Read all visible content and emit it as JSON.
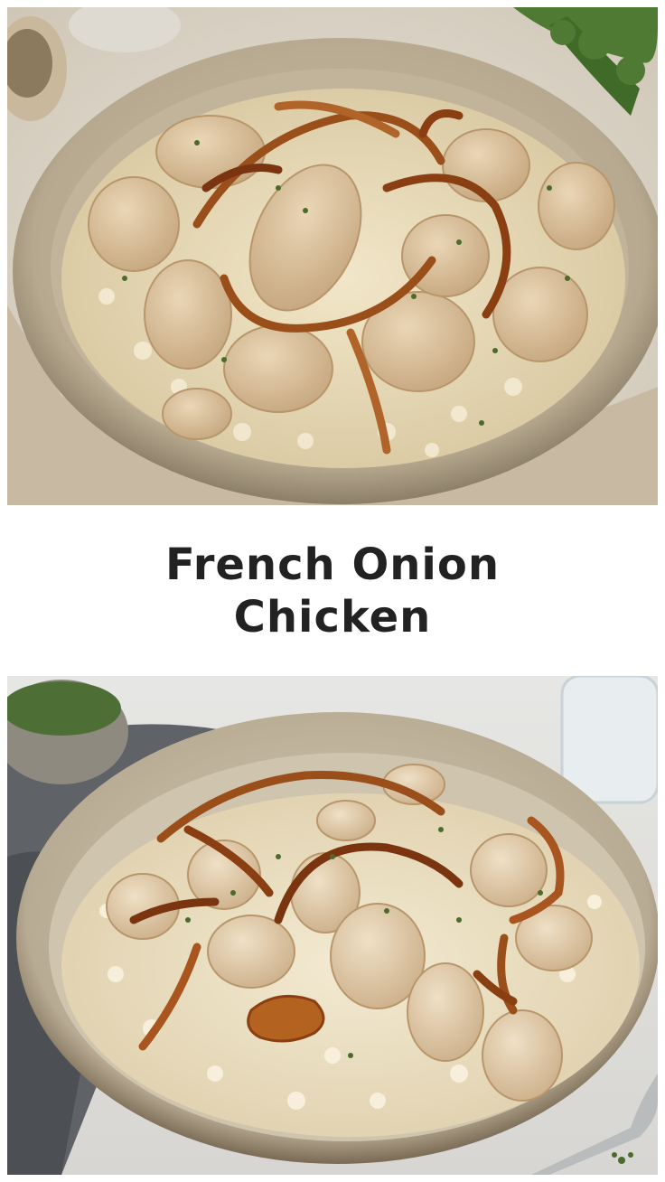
{
  "title": {
    "line1": "French Onion",
    "line2": "Chicken"
  },
  "colors": {
    "title_text": "#222222",
    "background": "#ffffff",
    "plate": "#d8cdb8",
    "rice": "#efe4c6",
    "chicken": "#dcc3a0",
    "onion": "#9a4e1a"
  }
}
